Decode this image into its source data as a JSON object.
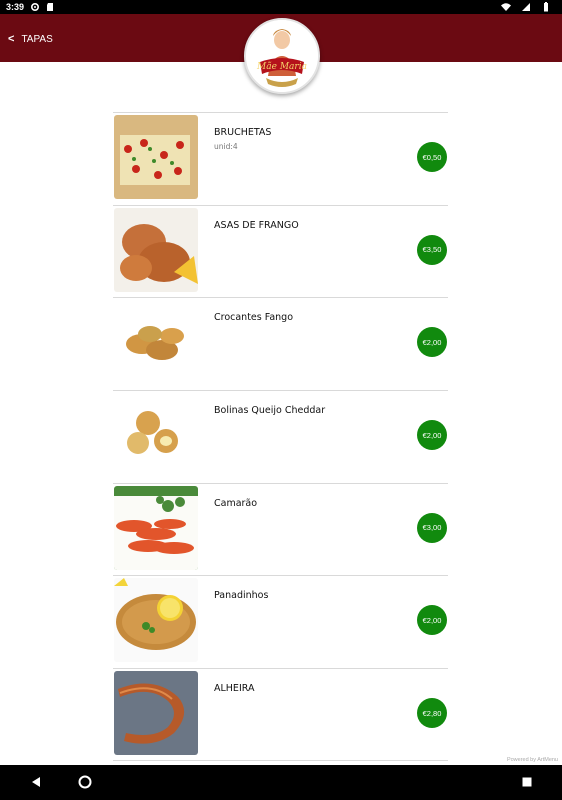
{
  "status_bar": {
    "time": "3:39",
    "icons": [
      "settings-icon",
      "sd-card-icon",
      "wifi-icon",
      "signal-icon",
      "battery-icon"
    ]
  },
  "header": {
    "back_label": "<",
    "title": "TAPAS",
    "logo_text": "Mãe Maria",
    "bg_color": "#6b0a12"
  },
  "items": [
    {
      "name": "BRUCHETAS",
      "subtitle": "unid:4",
      "price": "€0,50",
      "image": "bruschetta"
    },
    {
      "name": "ASAS DE FRANGO",
      "subtitle": "",
      "price": "€3,50",
      "image": "chicken-wings"
    },
    {
      "name": "Crocantes Fango",
      "subtitle": "",
      "price": "€2,00",
      "image": "chicken-nuggets"
    },
    {
      "name": "Bolinas Queijo Cheddar",
      "subtitle": "",
      "price": "€2,00",
      "image": "cheese-balls"
    },
    {
      "name": "Camarão",
      "subtitle": "",
      "price": "€3,00",
      "image": "shrimp"
    },
    {
      "name": "Panadinhos",
      "subtitle": "",
      "price": "€2,00",
      "image": "breaded-cutlet"
    },
    {
      "name": "ALHEIRA",
      "subtitle": "",
      "price": "€2,80",
      "image": "sausage"
    }
  ],
  "price_color": "#118a0e",
  "footer": {
    "powered": "Powered by ArtMenu"
  }
}
